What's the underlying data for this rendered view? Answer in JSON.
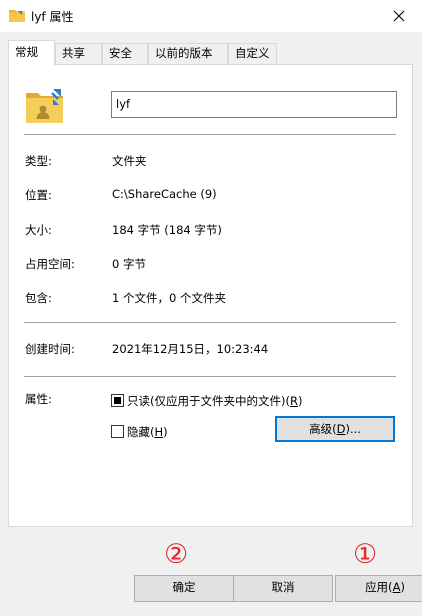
{
  "window": {
    "title": "lyf 属性",
    "close_icon": "close-icon"
  },
  "tabs": [
    {
      "label": "常规",
      "active": true
    },
    {
      "label": "共享",
      "active": false
    },
    {
      "label": "安全",
      "active": false
    },
    {
      "label": "以前的版本",
      "active": false
    },
    {
      "label": "自定义",
      "active": false
    }
  ],
  "general": {
    "name_value": "lyf",
    "rows": [
      {
        "label": "类型:",
        "value": "文件夹"
      },
      {
        "label": "位置:",
        "value": "C:\\ShareCache (9)"
      },
      {
        "label": "大小:",
        "value": "184 字节 (184 字节)"
      },
      {
        "label": "占用空间:",
        "value": "0 字节"
      },
      {
        "label": "包含:",
        "value": "1 个文件，0 个文件夹"
      }
    ],
    "created": {
      "label": "创建时间:",
      "value": "2021年12月15日，10:23:44"
    },
    "attributes": {
      "label": "属性:",
      "readonly_label": "只读(仅应用于文件夹中的文件)(",
      "readonly_key": "R",
      "readonly_tail": ")",
      "readonly_state": "indeterminate",
      "hidden_label": "隐藏(",
      "hidden_key": "H",
      "hidden_tail": ")",
      "hidden_checked": false,
      "advanced_label": "高级(",
      "advanced_key": "D",
      "advanced_tail": ")..."
    }
  },
  "buttons": {
    "ok": "确定",
    "cancel": "取消",
    "apply": "应用(",
    "apply_key": "A",
    "apply_tail": ")"
  },
  "annotations": {
    "mark_1": "①",
    "mark_2": "②"
  },
  "colors": {
    "accent": "#0078d7",
    "annotation": "#e5262b",
    "folder": "#f3c94a"
  }
}
